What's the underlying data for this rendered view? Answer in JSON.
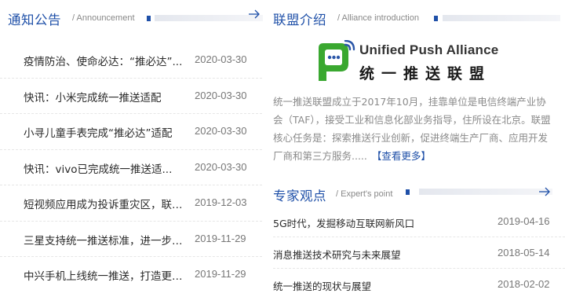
{
  "announcement": {
    "title": "通知公告",
    "subtitle": "/ Announcement",
    "more_icon": "arrow-right-icon",
    "items": [
      {
        "title": "疫情防治、使命必达：“推必达”...",
        "date": "2020-03-30"
      },
      {
        "title": "快讯：小米完成统一推送适配",
        "date": "2020-03-30"
      },
      {
        "title": "小寻儿童手表完成“推必达”适配",
        "date": "2020-03-30"
      },
      {
        "title": "快讯：vivo已完成统一推送适...",
        "date": "2020-03-30"
      },
      {
        "title": "短视频应用成为投诉重灾区，联盟...",
        "date": "2019-12-03"
      },
      {
        "title": "三星支持统一推送标准，进一步提...",
        "date": "2019-11-29"
      },
      {
        "title": "中兴手机上线统一推送，打造更可...",
        "date": "2019-11-29"
      }
    ]
  },
  "alliance": {
    "title": "联盟介绍",
    "subtitle": "/ Alliance introduction",
    "logo": {
      "name_en": "Unified Push Alliance",
      "name_cn": "统一推送联盟",
      "icon": "chat-bubble-signal-icon",
      "green": "#3aa830",
      "blue": "#2a56a8"
    },
    "intro_text": "统一推送联盟成立于2017年10月，挂靠单位是电信终端产业协会（TAF），接受工业和信息化部业务指导，住所设在北京。联盟核心任务是：探索推送行业创新，促进终端生产厂商、应用开发厂商和第三方服务.....",
    "more_link": "【查看更多】"
  },
  "expert": {
    "title": "专家观点",
    "subtitle": "/ Expert's point",
    "more_icon": "arrow-right-icon",
    "items": [
      {
        "title": "5G时代，发掘移动互联网新风口",
        "date": "2019-04-16"
      },
      {
        "title": "消息推送技术研究与未来展望",
        "date": "2018-05-14"
      },
      {
        "title": "统一推送的现状与展望",
        "date": "2018-02-02"
      }
    ]
  },
  "colors": {
    "accent": "#1f50a8",
    "text": "#2a2a2a",
    "muted": "#8a8a8a"
  }
}
